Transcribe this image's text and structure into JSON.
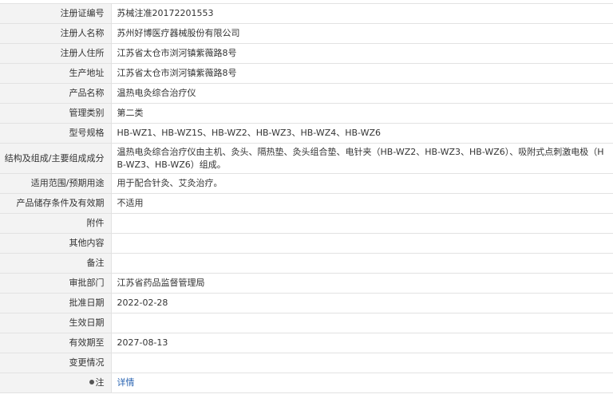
{
  "rows": [
    {
      "label": "注册证编号",
      "value": "苏械注准20172201553"
    },
    {
      "label": "注册人名称",
      "value": "苏州好博医疗器械股份有限公司"
    },
    {
      "label": "注册人住所",
      "value": "江苏省太仓市浏河镇紫薇路8号"
    },
    {
      "label": "生产地址",
      "value": "江苏省太仓市浏河镇紫薇路8号"
    },
    {
      "label": "产品名称",
      "value": "温热电灸综合治疗仪"
    },
    {
      "label": "管理类别",
      "value": "第二类"
    },
    {
      "label": "型号规格",
      "value": "HB-WZ1、HB-WZ1S、HB-WZ2、HB-WZ3、HB-WZ4、HB-WZ6"
    },
    {
      "label": "结构及组成/主要组成成分",
      "value": "温热电灸综合治疗仪由主机、灸头、隔热垫、灸头组合垫、电针夹（HB-WZ2、HB-WZ3、HB-WZ6）、吸附式点刺激电极（HB-WZ3、HB-WZ6）组成。"
    },
    {
      "label": "适用范围/预期用途",
      "value": "用于配合针灸、艾灸治疗。"
    },
    {
      "label": "产品储存条件及有效期",
      "value": "不适用"
    },
    {
      "label": "附件",
      "value": ""
    },
    {
      "label": "其他内容",
      "value": ""
    },
    {
      "label": "备注",
      "value": ""
    },
    {
      "label": "审批部门",
      "value": "江苏省药品监督管理局"
    },
    {
      "label": "批准日期",
      "value": "2022-02-28"
    },
    {
      "label": "生效日期",
      "value": ""
    },
    {
      "label": "有效期至",
      "value": "2027-08-13"
    },
    {
      "label": "变更情况",
      "value": ""
    }
  ],
  "note_row": {
    "label": "注",
    "link": "详情",
    "icon": "info-dot-icon"
  }
}
